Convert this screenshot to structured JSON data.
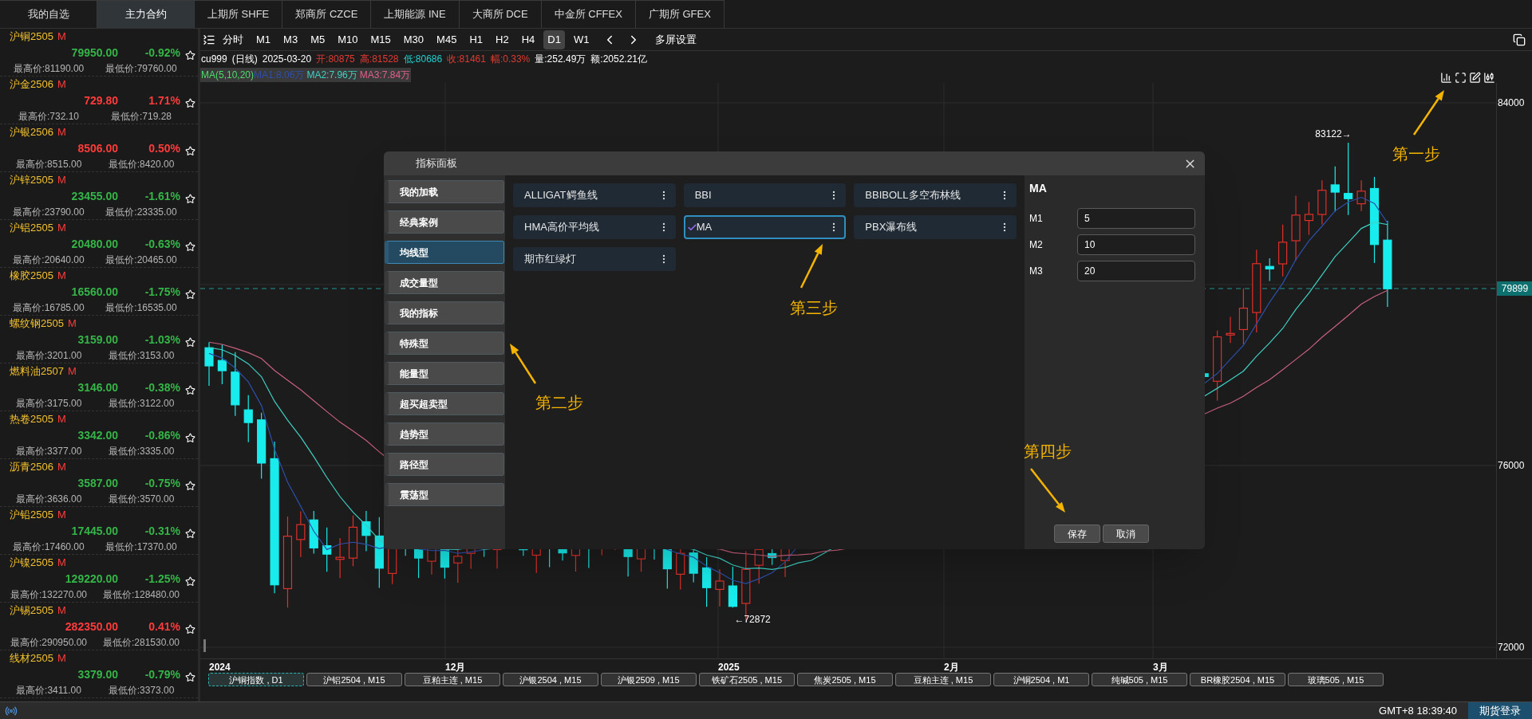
{
  "market_tabs": [
    {
      "label": "我的自选",
      "selected": false
    },
    {
      "label": "主力合约",
      "selected": true
    },
    {
      "label": "上期所 SHFE",
      "selected": false
    },
    {
      "label": "郑商所 CZCE",
      "selected": false
    },
    {
      "label": "上期能源 INE",
      "selected": false
    },
    {
      "label": "大商所 DCE",
      "selected": false
    },
    {
      "label": "中金所 CFFEX",
      "selected": false
    },
    {
      "label": "广期所 GFEX",
      "selected": false
    }
  ],
  "watchlist": [
    {
      "name": "沪铜2505",
      "tag": "M",
      "price": "79950.00",
      "change": "-0.92%",
      "rising": false,
      "high": "最高价:81190.00",
      "low": "最低价:79760.00"
    },
    {
      "name": "沪金2506",
      "tag": "M",
      "price": "729.80",
      "change": "1.71%",
      "rising": true,
      "high": "最高价:732.10",
      "low": "最低价:719.28"
    },
    {
      "name": "沪银2506",
      "tag": "M",
      "price": "8506.00",
      "change": "0.50%",
      "rising": true,
      "high": "最高价:8515.00",
      "low": "最低价:8420.00"
    },
    {
      "name": "沪锌2505",
      "tag": "M",
      "price": "23455.00",
      "change": "-1.61%",
      "rising": false,
      "high": "最高价:23790.00",
      "low": "最低价:23335.00"
    },
    {
      "name": "沪铝2505",
      "tag": "M",
      "price": "20480.00",
      "change": "-0.63%",
      "rising": false,
      "high": "最高价:20640.00",
      "low": "最低价:20465.00"
    },
    {
      "name": "橡胶2505",
      "tag": "M",
      "price": "16560.00",
      "change": "-1.75%",
      "rising": false,
      "high": "最高价:16785.00",
      "low": "最低价:16535.00"
    },
    {
      "name": "螺纹钢2505",
      "tag": "M",
      "price": "3159.00",
      "change": "-1.03%",
      "rising": false,
      "high": "最高价:3201.00",
      "low": "最低价:3153.00"
    },
    {
      "name": "燃料油2507",
      "tag": "M",
      "price": "3146.00",
      "change": "-0.38%",
      "rising": false,
      "high": "最高价:3175.00",
      "low": "最低价:3122.00"
    },
    {
      "name": "热卷2505",
      "tag": "M",
      "price": "3342.00",
      "change": "-0.86%",
      "rising": false,
      "high": "最高价:3377.00",
      "low": "最低价:3335.00"
    },
    {
      "name": "沥青2506",
      "tag": "M",
      "price": "3587.00",
      "change": "-0.75%",
      "rising": false,
      "high": "最高价:3636.00",
      "low": "最低价:3570.00"
    },
    {
      "name": "沪铅2505",
      "tag": "M",
      "price": "17445.00",
      "change": "-0.31%",
      "rising": false,
      "high": "最高价:17460.00",
      "low": "最低价:17370.00"
    },
    {
      "name": "沪镍2505",
      "tag": "M",
      "price": "129220.00",
      "change": "-1.25%",
      "rising": false,
      "high": "最高价:132270.00",
      "low": "最低价:128480.00"
    },
    {
      "name": "沪锡2505",
      "tag": "M",
      "price": "282350.00",
      "change": "0.41%",
      "rising": true,
      "high": "最高价:290950.00",
      "low": "最低价:281530.00"
    },
    {
      "name": "线材2505",
      "tag": "M",
      "price": "3379.00",
      "change": "-0.79%",
      "rising": false,
      "high": "最高价:3411.00",
      "low": "最低价:3373.00"
    }
  ],
  "toolbar": {
    "periods": [
      {
        "label": "分时",
        "selected": false
      },
      {
        "label": "M1",
        "selected": false
      },
      {
        "label": "M3",
        "selected": false
      },
      {
        "label": "M5",
        "selected": false
      },
      {
        "label": "M10",
        "selected": false
      },
      {
        "label": "M15",
        "selected": false
      },
      {
        "label": "M30",
        "selected": false
      },
      {
        "label": "M45",
        "selected": false
      },
      {
        "label": "H1",
        "selected": false
      },
      {
        "label": "H2",
        "selected": false
      },
      {
        "label": "H4",
        "selected": false
      },
      {
        "label": "D1",
        "selected": true
      },
      {
        "label": "W1",
        "selected": false
      }
    ],
    "layout_button": "多屏设置"
  },
  "quote": {
    "symbol": "cu999",
    "period": "(日线)",
    "date": "2025-03-20",
    "open": "开:80875",
    "high": "高:81528",
    "low": "低:80686",
    "close": "收:81461",
    "range": "幅:0.33%",
    "volume": "量:252.49万",
    "amount": "额:2052.21亿"
  },
  "ma_legend": {
    "params": "MA(5,10,20)",
    "ma1": "MA1:8.06万",
    "ma2": "MA2:7.96万",
    "ma3": "MA3:7.84万"
  },
  "chart": {
    "price_labels": [
      "84000",
      "76000",
      "72000"
    ],
    "last_price": "79899",
    "date_labels": [
      "2024",
      "12月",
      "2025",
      "2月",
      "3月"
    ],
    "high_marker": "83122→",
    "low_marker": "←72872"
  },
  "chart_tabs": [
    {
      "label": "沪铜指数 , D1",
      "selected": true
    },
    {
      "label": "沪铝2504 , M15",
      "selected": false
    },
    {
      "label": "豆粕主连 , M15",
      "selected": false
    },
    {
      "label": "沪银2504 , M15",
      "selected": false
    },
    {
      "label": "沪银2509 , M15",
      "selected": false
    },
    {
      "label": "铁矿石2505 , M15",
      "selected": false
    },
    {
      "label": "焦炭2505 , M15",
      "selected": false
    },
    {
      "label": "豆粕主连 , M15",
      "selected": false
    },
    {
      "label": "沪铜2504 , M1",
      "selected": false
    },
    {
      "label": "纯碱505 , M15",
      "selected": false
    },
    {
      "label": "BR橡胶2504 , M15",
      "selected": false
    },
    {
      "label": "玻璃505 , M15",
      "selected": false
    }
  ],
  "indicator_dialog": {
    "title": "指标面板",
    "categories": [
      {
        "label": "我的加载",
        "selected": false
      },
      {
        "label": "经典案例",
        "selected": false
      },
      {
        "label": "均线型",
        "selected": true
      },
      {
        "label": "成交量型",
        "selected": false
      },
      {
        "label": "我的指标",
        "selected": false
      },
      {
        "label": "特殊型",
        "selected": false
      },
      {
        "label": "能量型",
        "selected": false
      },
      {
        "label": "超买超卖型",
        "selected": false
      },
      {
        "label": "趋势型",
        "selected": false
      },
      {
        "label": "路径型",
        "selected": false
      },
      {
        "label": "震荡型",
        "selected": false
      }
    ],
    "indicators": [
      {
        "label": "ALLIGAT鳄鱼线",
        "selected": false
      },
      {
        "label": "BBI",
        "selected": false
      },
      {
        "label": "BBIBOLL多空布林线",
        "selected": false
      },
      {
        "label": "HMA高价平均线",
        "selected": false
      },
      {
        "label": "MA",
        "selected": true
      },
      {
        "label": "PBX瀑布线",
        "selected": false
      },
      {
        "label": "期市红绿灯",
        "selected": false
      }
    ],
    "params_title": "MA",
    "params": [
      {
        "label": "M1",
        "value": "5"
      },
      {
        "label": "M2",
        "value": "10"
      },
      {
        "label": "M3",
        "value": "20"
      }
    ],
    "buttons": [
      "保存",
      "取消"
    ]
  },
  "annotations": [
    "第一步",
    "第二步",
    "第三步",
    "第四步"
  ],
  "status_bar": {
    "time": "GMT+8 18:39:40",
    "login_button": "期货登录"
  }
}
